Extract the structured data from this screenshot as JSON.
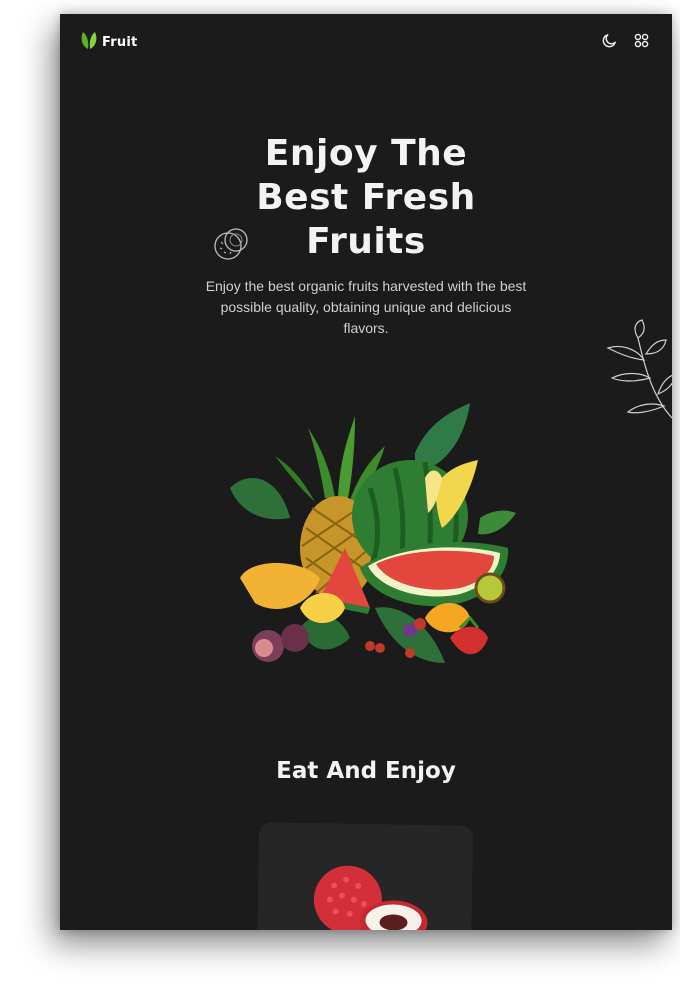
{
  "header": {
    "logo_text": "Fruit",
    "logo_icon": "leaf-icon",
    "theme_icon": "moon-icon",
    "menu_icon": "grid-icon"
  },
  "hero": {
    "title_lines": [
      "Enjoy The",
      "Best Fresh",
      "Fruits"
    ],
    "description": "Enjoy the best organic fruits harvested with the best possible quality, obtaining unique and delicious flavors."
  },
  "section": {
    "title": "Eat And Enjoy"
  },
  "colors": {
    "background": "#1b1b1b",
    "card": "#262626",
    "accent_green": "#6fbf2f",
    "text": "#f3f3f3"
  }
}
